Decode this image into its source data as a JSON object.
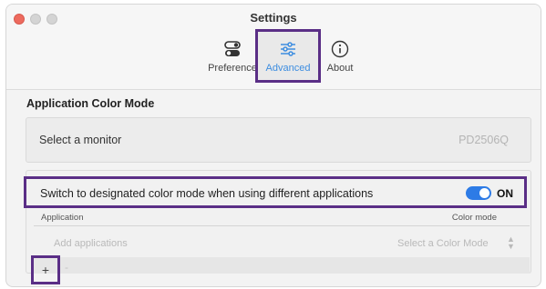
{
  "window": {
    "title": "Settings"
  },
  "tabs": [
    {
      "label": "Preference",
      "icon": "toggle-switches-icon"
    },
    {
      "label": "Advanced",
      "icon": "sliders-icon",
      "active": true
    },
    {
      "label": "About",
      "icon": "info-icon"
    }
  ],
  "section": {
    "title": "Application Color Mode"
  },
  "monitor": {
    "label": "Select a monitor",
    "value": "PD2506Q"
  },
  "switch": {
    "label": "Switch to designated color mode when using different applications",
    "state": "ON"
  },
  "table": {
    "col_application": "Application",
    "col_color_mode": "Color mode",
    "add_placeholder": "Add applications",
    "select_placeholder": "Select a Color Mode"
  },
  "buttons": {
    "add": "+",
    "remove": "-"
  },
  "colors": {
    "accent": "#3d8de0",
    "toggle_on": "#2d7be6",
    "highlight": "#5a2e86",
    "close": "#ed6a5e"
  }
}
